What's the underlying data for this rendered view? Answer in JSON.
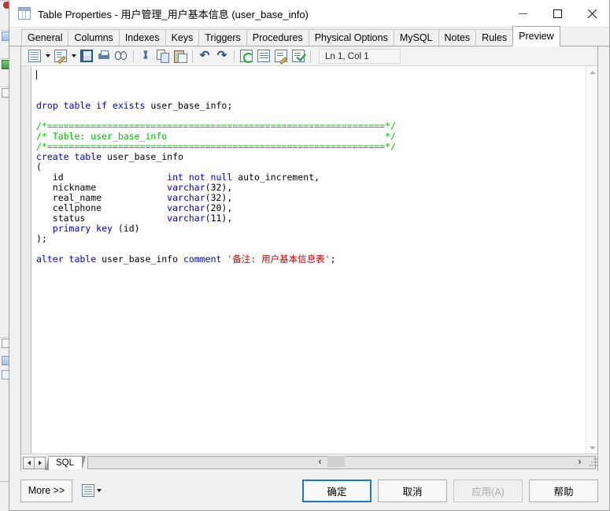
{
  "window": {
    "title": "Table Properties - 用户管理_用户基本信息 (user_base_info)",
    "icon": "table-icon",
    "controls": {
      "minimize": "minimize-icon",
      "maximize": "maximize-icon",
      "close": "close-icon"
    }
  },
  "tabs": [
    {
      "label": "General",
      "active": false
    },
    {
      "label": "Columns",
      "active": false
    },
    {
      "label": "Indexes",
      "active": false
    },
    {
      "label": "Keys",
      "active": false
    },
    {
      "label": "Triggers",
      "active": false
    },
    {
      "label": "Procedures",
      "active": false
    },
    {
      "label": "Physical Options",
      "active": false
    },
    {
      "label": "MySQL",
      "active": false
    },
    {
      "label": "Notes",
      "active": false
    },
    {
      "label": "Rules",
      "active": false
    },
    {
      "label": "Preview",
      "active": true
    }
  ],
  "editor_toolbar": {
    "items": [
      {
        "icon": "document-icon",
        "has_dropdown": true
      },
      {
        "icon": "document-edit-icon",
        "has_dropdown": true
      },
      {
        "icon": "save-icon",
        "has_dropdown": false
      },
      {
        "icon": "print-icon",
        "has_dropdown": false
      },
      {
        "icon": "find-binoculars-icon",
        "has_dropdown": false
      },
      {
        "icon": "cut-scissors-icon",
        "has_dropdown": false
      },
      {
        "icon": "copy-icon",
        "has_dropdown": false
      },
      {
        "icon": "paste-icon",
        "has_dropdown": false
      },
      {
        "icon": "undo-icon",
        "has_dropdown": false
      },
      {
        "icon": "redo-icon",
        "has_dropdown": false
      },
      {
        "icon": "refresh-icon",
        "has_dropdown": false
      },
      {
        "icon": "list-icon",
        "has_dropdown": false
      },
      {
        "icon": "edit-script-icon",
        "has_dropdown": false
      },
      {
        "icon": "validate-check-icon",
        "has_dropdown": false
      }
    ],
    "cursor_position": "Ln 1, Col 1"
  },
  "code": {
    "lines": [
      [
        {
          "t": "drop table if exists",
          "c": "k"
        },
        {
          "t": " user_base_info;",
          "c": ""
        }
      ],
      [],
      [
        {
          "t": "/*==============================================================*/",
          "c": "cm"
        }
      ],
      [
        {
          "t": "/* Table: user_base_info                                        */",
          "c": "cm"
        }
      ],
      [
        {
          "t": "/*==============================================================*/",
          "c": "cm"
        }
      ],
      [
        {
          "t": "create table",
          "c": "k"
        },
        {
          "t": " user_base_info",
          "c": ""
        }
      ],
      [
        {
          "t": "(",
          "c": ""
        }
      ],
      [
        {
          "t": "   id                   ",
          "c": ""
        },
        {
          "t": "int not null",
          "c": "k"
        },
        {
          "t": " auto_increment,",
          "c": ""
        }
      ],
      [
        {
          "t": "   nickname             ",
          "c": ""
        },
        {
          "t": "varchar",
          "c": "k"
        },
        {
          "t": "(32),",
          "c": ""
        }
      ],
      [
        {
          "t": "   real_name            ",
          "c": ""
        },
        {
          "t": "varchar",
          "c": "k"
        },
        {
          "t": "(32),",
          "c": ""
        }
      ],
      [
        {
          "t": "   cellphone            ",
          "c": ""
        },
        {
          "t": "varchar",
          "c": "k"
        },
        {
          "t": "(20),",
          "c": ""
        }
      ],
      [
        {
          "t": "   status               ",
          "c": ""
        },
        {
          "t": "varchar",
          "c": "k"
        },
        {
          "t": "(11),",
          "c": ""
        }
      ],
      [
        {
          "t": "   ",
          "c": ""
        },
        {
          "t": "primary key",
          "c": "k"
        },
        {
          "t": " (id)",
          "c": ""
        }
      ],
      [
        {
          "t": ");",
          "c": ""
        }
      ],
      [],
      [
        {
          "t": "alter table",
          "c": "k"
        },
        {
          "t": " user_base_info ",
          "c": ""
        },
        {
          "t": "comment",
          "c": "k"
        },
        {
          "t": " ",
          "c": ""
        },
        {
          "t": "'备注: 用户基本信息表'",
          "c": "str"
        },
        {
          "t": ";",
          "c": ""
        }
      ]
    ],
    "colors": {
      "keyword": "#0000cc",
      "comment": "#00c000",
      "string": "#cc0000",
      "plain": "#000000"
    }
  },
  "sheet_bar": {
    "prev_icon": "nav-prev-icon",
    "next_icon": "nav-next-icon",
    "tab_label": "SQL"
  },
  "scrollbars": {
    "vertical_up_icon": "scroll-up-icon",
    "vertical_down_icon": "scroll-down-icon",
    "horizontal_left_icon": "scroll-left-icon",
    "horizontal_right_icon": "scroll-right-icon",
    "left_glyph": "‹",
    "right_glyph": "›"
  },
  "buttons": {
    "more": "More >>",
    "more_icon": "script-icon",
    "ok": "确定",
    "cancel": "取消",
    "apply": "应用(A)",
    "help": "帮助"
  }
}
